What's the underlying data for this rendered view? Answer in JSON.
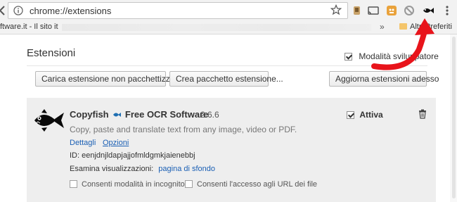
{
  "toolbar": {
    "url": "chrome://extensions"
  },
  "bookmarks": {
    "first_item": "ftware.it - Il sito it",
    "chevron": "»",
    "other_folder": "Altri Preferiti"
  },
  "page": {
    "title": "Estensioni",
    "developer_mode_label": "Modalità sviluppatore",
    "developer_mode_checked": true
  },
  "buttons": {
    "load_unpacked": "Carica estensione non pacchettizzata...",
    "pack": "Crea pacchetto estensione...",
    "update": "Aggiorna estensioni adesso"
  },
  "extension": {
    "name_part1": "Copyfish",
    "name_part2": "Free OCR Software",
    "version": "2.6.6",
    "active_label": "Attiva",
    "active_checked": true,
    "description": "Copy, paste and translate text from any image, video or PDF.",
    "details_link": "Dettagli",
    "options_link": "Opzioni",
    "id_label": "ID: eenjdnjldapjajjofmldgmkjaienebbj",
    "inspect_label": "Esamina visualizzazioni:",
    "inspect_link": "pagina di sfondo",
    "incognito_label": "Consenti modalità in incognito",
    "file_urls_label": "Consenti l'accesso agli URL dei file"
  },
  "colors": {
    "annotation_arrow": "#e8141b",
    "link": "#1a5fb4",
    "card_background": "#eeeeee"
  }
}
